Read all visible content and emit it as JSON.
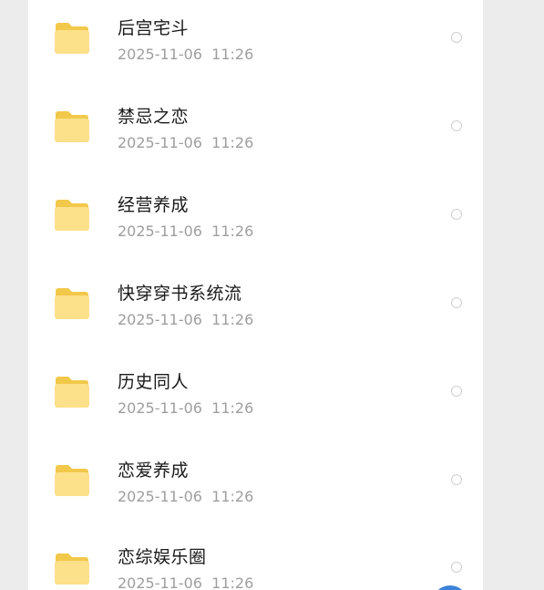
{
  "folders": [
    {
      "name": "后宫宅斗",
      "date": "2025-11-06  11:26"
    },
    {
      "name": "禁忌之恋",
      "date": "2025-11-06  11:26"
    },
    {
      "name": "经营养成",
      "date": "2025-11-06  11:26"
    },
    {
      "name": "快穿穿书系统流",
      "date": "2025-11-06  11:26"
    },
    {
      "name": "历史同人",
      "date": "2025-11-06  11:26"
    },
    {
      "name": "恋爱养成",
      "date": "2025-11-06  11:26"
    },
    {
      "name": "恋综娱乐圈",
      "date": "2025-11-06  11:26"
    }
  ],
  "icons": {
    "folder": "folder-icon",
    "select": "radio-circle"
  },
  "colors": {
    "background": "#ececec",
    "card": "#ffffff",
    "folder_back": "#f2c84b",
    "folder_front": "#fde08a",
    "name_text": "#1a1a1a",
    "date_text": "#9e9e9e",
    "radio_border": "#cfcfcf",
    "accent": "#3b82d9"
  }
}
